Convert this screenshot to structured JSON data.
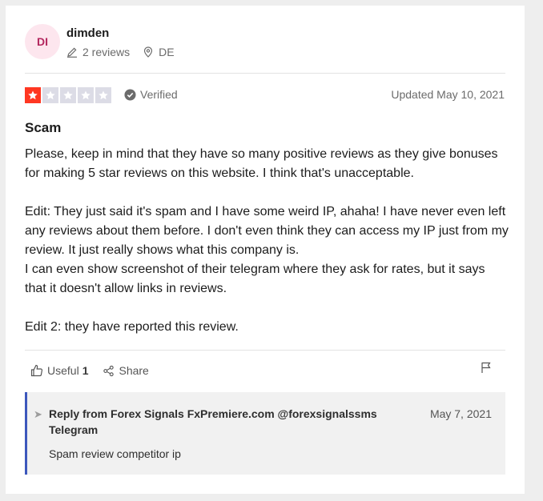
{
  "reviewer": {
    "initials": "DI",
    "name": "dimden",
    "reviews": "2 reviews",
    "country": "DE"
  },
  "review": {
    "rating": 1,
    "max_rating": 5,
    "verified_label": "Verified",
    "date": "Updated May 10, 2021",
    "title": "Scam",
    "paragraphs": [
      "Please, keep in mind that they have so many positive reviews as they give bonuses for making 5 star reviews on this website. I think that's unacceptable.",
      "Edit: They just said it's spam and I have some weird IP, ahaha! I have never even left any reviews about them before. I don't even think they can access my IP just from my review. It just really shows what this company is.\nI can even show screenshot of their telegram where they ask for rates, but it says that it doesn't allow links in reviews.",
      "Edit 2: they have reported this review."
    ]
  },
  "actions": {
    "useful_label": "Useful",
    "useful_count": "1",
    "share_label": "Share"
  },
  "reply": {
    "title": "Reply from Forex Signals FxPremiere.com @forexsignalssms Telegram",
    "date": "May 7, 2021",
    "text": "Spam review competitor ip"
  },
  "colors": {
    "star_active": "#ff3722",
    "star_inactive": "#dcdce6",
    "reply_accent": "#3c57bc",
    "avatar_bg": "#fde6ee",
    "avatar_text": "#b3275e"
  }
}
